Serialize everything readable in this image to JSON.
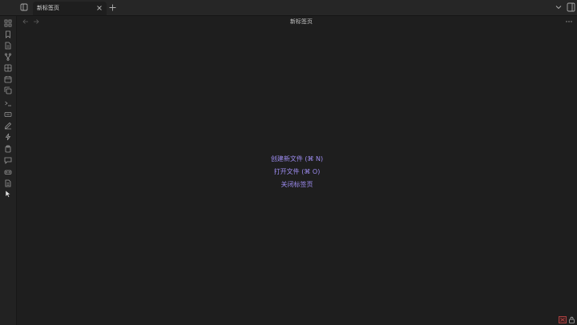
{
  "tabs": [
    {
      "title": "新标签页",
      "active": true
    }
  ],
  "view": {
    "title": "新标签页"
  },
  "empty_state": {
    "actions": [
      {
        "label": "创建新文件 (⌘ N)"
      },
      {
        "label": "打开文件 (⌘ O)"
      },
      {
        "label": "关闭标签页"
      }
    ]
  },
  "ribbon": {
    "icons": [
      "grid-icon",
      "bookmark-icon",
      "file-icon",
      "fork-icon",
      "dashboard-icon",
      "calendar-icon",
      "copy-icon",
      "terminal-icon",
      "keyboard-icon",
      "pen-icon",
      "bolt-icon",
      "clipboard-icon",
      "chat-icon",
      "vr-icon",
      "document-icon",
      "cursor-icon"
    ]
  },
  "colors": {
    "background": "#1e1e1e",
    "titlebar": "#262626",
    "accent": "#9d8cf0",
    "sync_status": "#c94a4a"
  }
}
